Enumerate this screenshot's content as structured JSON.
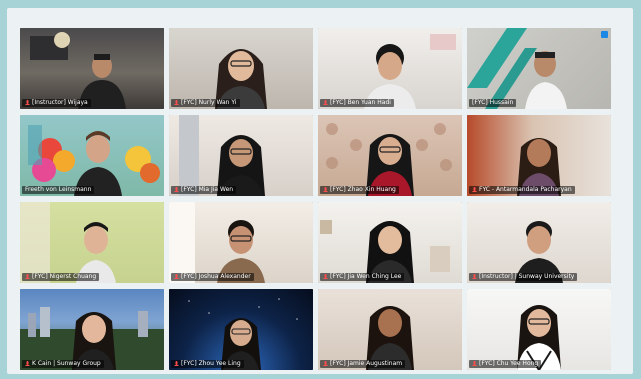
{
  "participants": [
    {
      "name": "[Instructor] Wijaya",
      "active": false
    },
    {
      "name": "[FYC] Nurly Wan Yi",
      "active": false
    },
    {
      "name": "[FYC] Ben Yuan Hadi",
      "active": false
    },
    {
      "name": "[FYC] Hussain",
      "active": false
    },
    {
      "name": "Freeth von Leinsmann",
      "active": true
    },
    {
      "name": "[FYC] Mia Jia Wen",
      "active": false
    },
    {
      "name": "[FYC] Zhao Xin Huang",
      "active": false
    },
    {
      "name": "FYC - Antarmandala Pacharyan",
      "active": false
    },
    {
      "name": "[FYC] Nigerst Chuang",
      "active": false
    },
    {
      "name": "[FYC] Joshua Alexander",
      "active": false
    },
    {
      "name": "[FYC] Jia Wen Ching Lee",
      "active": false
    },
    {
      "name": "[Instructor] | Sunway University",
      "active": false
    },
    {
      "name": "K Cain | Sunway Group",
      "active": false
    },
    {
      "name": "[FYC] Zhou Yee Ling",
      "active": false
    },
    {
      "name": "[FYC] Jamie Augustinam",
      "active": false
    },
    {
      "name": "[FYC] Chu Yee Hong",
      "active": false
    }
  ],
  "colors": {
    "active_border": "#d6e63b",
    "label_bg": "#000000",
    "mic_muted": "#ff4d4d",
    "screen_share_badge": "#1e88e5"
  }
}
